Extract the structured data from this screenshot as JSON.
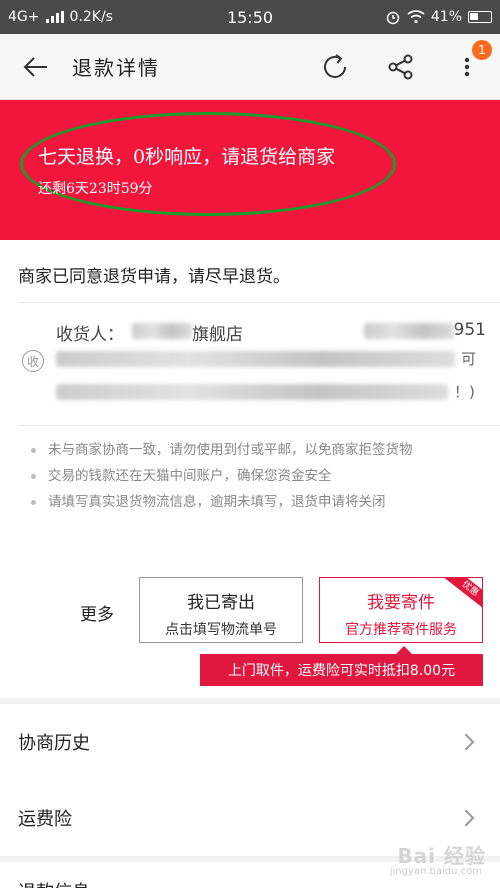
{
  "status_bar": {
    "network": "4G+",
    "speed": "0.2K/s",
    "time": "15:50",
    "battery": "41%"
  },
  "nav": {
    "title": "退款详情",
    "badge_count": "1"
  },
  "banner": {
    "title": "七天退换，0秒响应，请退货给商家",
    "countdown": "还剩6天23时59分",
    "background_color": "#f2163d",
    "annotation_color": "#1b9a2e"
  },
  "info": {
    "agree_text": "商家已同意退货申请，请尽早退货。",
    "receiver_label": "收货人：",
    "receiver_store_suffix": "旗舰店",
    "phone_suffix": "951",
    "address_icon_text": "收",
    "address_end": "可",
    "address_paren": "！)"
  },
  "tips": [
    "未与商家协商一致，请勿使用到付或平邮，以免商家拒签货物",
    "交易的钱款还在天猫中间账户，确保您资金安全",
    "请填写真实退货物流信息，逾期未填写，退货申请将关闭"
  ],
  "actions": {
    "more_label": "更多",
    "sent": {
      "line1": "我已寄出",
      "line2": "点击填写物流单号"
    },
    "pickup": {
      "line1": "我要寄件",
      "line2": "官方推荐寄件服务",
      "corner": "优惠"
    },
    "tooltip": "上门取件，运费险可实时抵扣8.00元",
    "accent_color": "#e0173e"
  },
  "list": {
    "history": "协商历史",
    "insurance": "运费险",
    "refund_info": "退款信息"
  },
  "watermark": {
    "main": "Bai 经验",
    "sub": "jingyan.baidu.com"
  }
}
